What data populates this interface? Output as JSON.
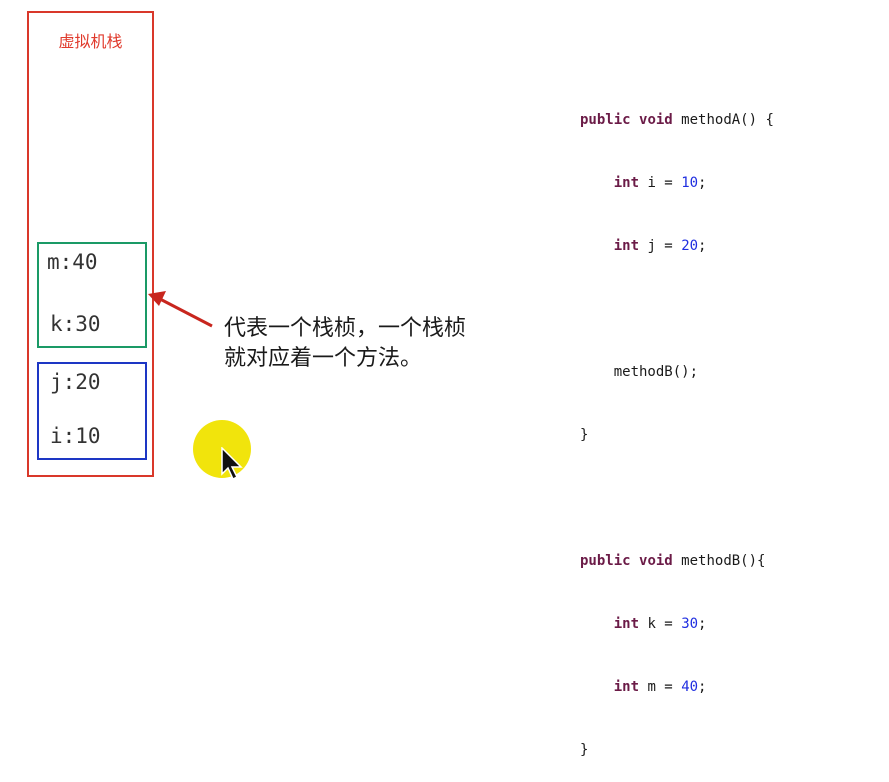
{
  "stack": {
    "title": "虚拟机栈",
    "frames": [
      {
        "id": "methodB",
        "vars": [
          "m:40",
          "k:30"
        ],
        "color": "#1a9a66"
      },
      {
        "id": "methodA",
        "vars": [
          "j:20",
          "i:10"
        ],
        "color": "#1d36c4"
      }
    ],
    "border_color": "#d9382a"
  },
  "annotation": {
    "line1": "代表一个栈桢，一个栈桢",
    "line2": "就对应着一个方法。",
    "arrow_color": "#c8261e"
  },
  "code": {
    "methodA": {
      "kw_public": "public",
      "kw_void": "void",
      "signature": "methodA() {",
      "l1_type": "int",
      "l1_name": "i =",
      "l1_val": "10",
      "l1_end": ";",
      "l2_type": "int",
      "l2_name": "j =",
      "l2_val": "20",
      "l2_end": ";",
      "call": "methodB();",
      "close": "}"
    },
    "methodB": {
      "kw_public": "public",
      "kw_void": "void",
      "signature": "methodB(){",
      "l1_type": "int",
      "l1_name": "k =",
      "l1_val": "30",
      "l1_end": ";",
      "l2_type": "int",
      "l2_name": "m =",
      "l2_val": "40",
      "l2_end": ";",
      "close": "}"
    }
  },
  "cursor": {
    "icon": "arrow-pointer-icon",
    "highlight": "#f1e40c"
  }
}
